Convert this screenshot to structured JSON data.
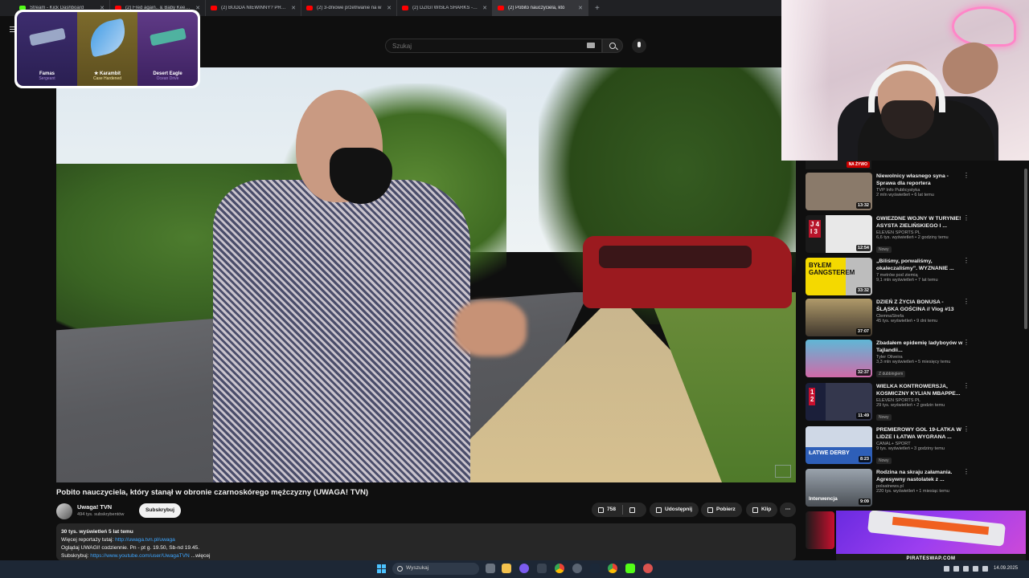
{
  "browser": {
    "tabs": [
      {
        "title": "Stream - Kick Dashboard",
        "icon": "kick-icon",
        "active": false
      },
      {
        "title": "(2) Fred again.. & Baby Keem -",
        "icon": "youtube-icon",
        "active": false
      },
      {
        "title": "(2) BUDDA NIEWINNY? PRZEŚ",
        "icon": "youtube-icon",
        "active": false
      },
      {
        "title": "(2) 3-dniowe przetrwanie na w",
        "icon": "youtube-icon",
        "active": false
      },
      {
        "title": "(2) DZIGI WISŁA SHARKS - O K",
        "icon": "youtube-icon",
        "active": false
      },
      {
        "title": "(2) Pobito nauczyciela, któ",
        "icon": "youtube-icon",
        "active": true
      }
    ],
    "new_tab": "+"
  },
  "header": {
    "search_placeholder": "Szukaj"
  },
  "skin_overlay": {
    "cards": [
      {
        "name": "Famas",
        "sub": "Sergeant"
      },
      {
        "name": "★ Karambit",
        "sub": "Case Hardened"
      },
      {
        "name": "Desert Eagle",
        "sub": "Ocean Drive"
      }
    ]
  },
  "video": {
    "title": "Pobito nauczyciela, który stanął w obronie czarnoskórego mężczyzny (UWAGA! TVN)",
    "channel": "Uwaga! TVN",
    "subscribers": "494 tys. subskrybentów",
    "subscribe_label": "Subskrybuj",
    "likes": "758",
    "share_label": "Udostępnij",
    "download_label": "Pobierz",
    "clip_label": "Klip",
    "more_label": "⋯"
  },
  "description": {
    "stats": "30 tys. wyświetleń  5 lat temu",
    "line1_text": "Więcej reportaży tutaj: ",
    "line1_link": "http://uwaga.tvn.pl/uwaga",
    "line2": "Oglądaj UWAGI! codziennie. Pn - pt g. 19.50, Sb-nd 19.45.",
    "line3_text": "Subskrybuj: ",
    "line3_link": "https://www.youtube.com/user/UwagaTVN",
    "line3_more": "...więcej"
  },
  "related": {
    "live_label": "NA ŻYWO",
    "items": [
      {
        "title": "Niewolnicy własnego syna - Sprawa dla reportera",
        "channel": "TVP Info Publicystyka",
        "stats": "2 mln wyświetleń • 6 lat temu",
        "duration": "13:32",
        "badge": "",
        "thumb_color": "#8a7a6a",
        "thumb_label": ""
      },
      {
        "title": "GWIEZDNE WOJNY W TURYNIE! ASYSTA ZIELIŃSKIEGO I ...",
        "channel": "ELEVEN SPORTS PL",
        "stats": "6,6 tys. wyświetleń • 2 godziny temu",
        "duration": "12:54",
        "badge": "Nowy",
        "thumb_color": "#b8152b",
        "thumb_label": "J 4\nI 3"
      },
      {
        "title": "„Biliśmy, porwaliśmy, okaleczaliśmy”. WYZNANIE ...",
        "channel": "7 metrów pod ziemią",
        "stats": "9,1 mln wyświetleń • 7 lat temu",
        "duration": "33:32",
        "badge": "",
        "thumb_color": "#f4d900",
        "thumb_label": "BYŁEM\nGANGSTEREM"
      },
      {
        "title": "DZIEŃ Z ŻYCIA BONUSA - ŚLĄSKA GOŚCINA // Vlog #13",
        "channel": "ClemnaStrefa",
        "stats": "45 tys. wyświetleń • 9 dni temu",
        "duration": "37:07",
        "badge": "",
        "thumb_color": "#5c5042",
        "thumb_label": ""
      },
      {
        "title": "Zbadałem epidemię ladyboyów w Tajlandii...",
        "channel": "Tyler Oliveira",
        "stats": "3,3 mln wyświetleń • 5 miesięcy temu",
        "duration": "32:37",
        "badge": "Z dubbingiem",
        "thumb_color": "#3a8fb0",
        "thumb_label": ""
      },
      {
        "title": "WIELKA KONTROWERSJA, KOSMICZNY KYLIAN MBAPPE...",
        "channel": "ELEVEN SPORTS PL",
        "stats": "29 tys. wyświetleń • 2 godzin temu",
        "duration": "11:49",
        "badge": "Nowy",
        "thumb_color": "#c8102e",
        "thumb_label": "1\n2"
      },
      {
        "title": "PREMIEROWY GOL 19-LATKA W LIDZE I ŁATWA WYGRANA ...",
        "channel": "CANAL+ SPORT",
        "stats": "9 tys. wyświetleń • 3 godziny temu",
        "duration": "8:23",
        "badge": "Nowy",
        "thumb_color": "#2e5fb8",
        "thumb_label": "ŁATWE DERBY"
      },
      {
        "title": "Rodzina na skraju załamania. Agresywny nastolatek z ...",
        "channel": "polsatnews.pl",
        "stats": "220 tys. wyświetleń • 1 miesiąc temu",
        "duration": "9:09",
        "badge": "",
        "thumb_color": "#6a6e74",
        "thumb_label": "Interwencja"
      }
    ]
  },
  "promo": {
    "site": "PIRATESWAP.COM"
  },
  "taskbar": {
    "search_label": "Wyszukaj",
    "date": "14.09.2025"
  }
}
